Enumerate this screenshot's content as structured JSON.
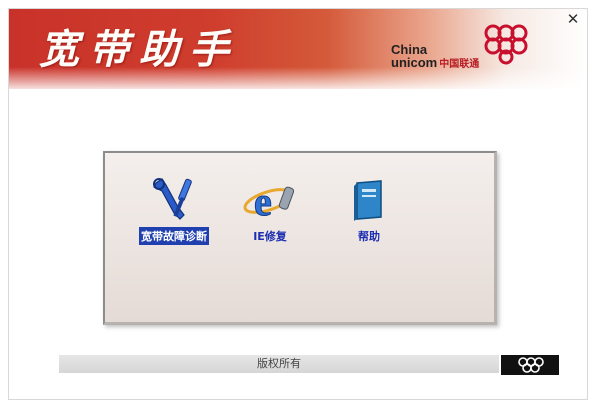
{
  "header": {
    "title": "宽带助手",
    "brand_line1": "China",
    "brand_line2": "unicom",
    "brand_cn": "中国联通",
    "close_symbol": "✕"
  },
  "tools": [
    {
      "label": "宽带故障诊断",
      "icon": "wrench-screwdriver-icon",
      "selected": true
    },
    {
      "label": "IE修复",
      "icon": "internet-explorer-icon",
      "selected": false
    },
    {
      "label": "帮助",
      "icon": "help-book-icon",
      "selected": false
    }
  ],
  "footer": {
    "copyright": "版权所有"
  },
  "colors": {
    "banner_red": "#c9322a",
    "label_blue": "#1c2fb3",
    "selection_blue": "#2140b0",
    "unicom_red": "#c8102e"
  }
}
